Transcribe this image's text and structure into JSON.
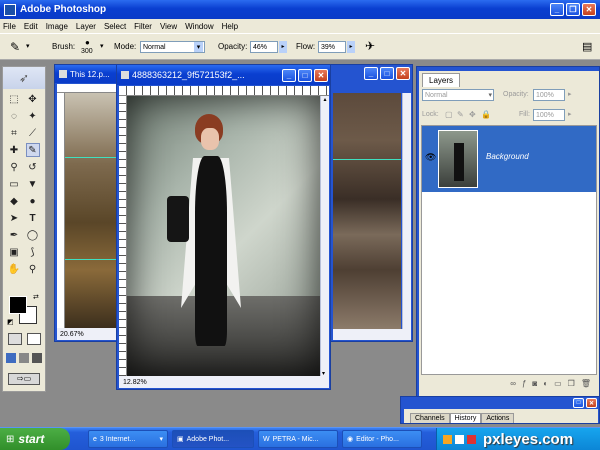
{
  "window": {
    "title": "Adobe Photoshop"
  },
  "menu": [
    "File",
    "Edit",
    "Image",
    "Layer",
    "Select",
    "Filter",
    "View",
    "Window",
    "Help"
  ],
  "options": {
    "brush_label": "Brush:",
    "brush_size": "300",
    "mode_label": "Mode:",
    "mode_value": "Normal",
    "opacity_label": "Opacity:",
    "opacity_value": "46%",
    "flow_label": "Flow:",
    "flow_value": "39%"
  },
  "doc_left": {
    "title": "This 12.p...",
    "zoom": "20.67%"
  },
  "doc_main": {
    "title": "4888363212_9f572153f2_...",
    "zoom": "12.82%"
  },
  "layers": {
    "tab": "Layers",
    "blend_mode": "Normal",
    "opacity_label": "Opacity:",
    "opacity_value": "100%",
    "lock_label": "Lock:",
    "fill_label": "Fill:",
    "fill_value": "100%",
    "items": [
      {
        "name": "Background"
      }
    ]
  },
  "history_panel": {
    "tabs": [
      "Channels",
      "History",
      "Actions"
    ]
  },
  "taskbar": {
    "start": "start",
    "tasks": [
      "3 Internet...",
      "Adobe Phot...",
      "PETRA - Mic...",
      "Editor - Pho..."
    ],
    "brand": "pxleyes.com"
  },
  "colors": {
    "accent": "#0a3fd0",
    "taskbar": "#245edb",
    "start": "#3c9a37",
    "layer_selected": "#316ac5"
  }
}
